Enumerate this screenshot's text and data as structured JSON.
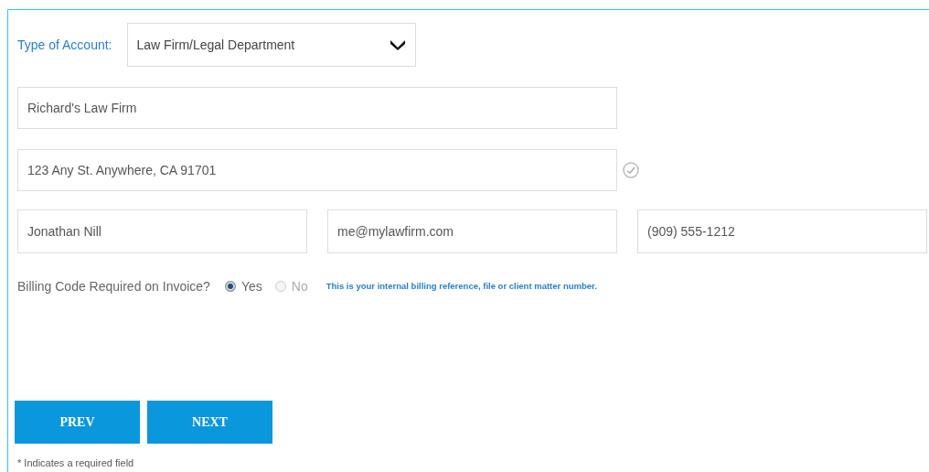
{
  "account_type": {
    "label": "Type of Account:",
    "value": "Law Firm/Legal Department"
  },
  "fields": [
    {
      "value": "Richard's Law Firm",
      "verified": false
    },
    {
      "value": "123 Any St. Anywhere, CA 91701",
      "verified": true
    }
  ],
  "contact_fields": [
    {
      "value": "Jonathan Nill"
    },
    {
      "value": "me@mylawfirm.com"
    },
    {
      "value": "(909) 555-1212"
    }
  ],
  "billing_code": {
    "question": "Billing Code Required on Invoice?",
    "options": [
      {
        "label": "Yes",
        "selected": true
      },
      {
        "label": "No",
        "selected": false
      }
    ],
    "hint": "This is your internal billing reference, file or client matter number."
  },
  "buttons": [
    "PREV",
    "NEXT"
  ],
  "footnote": "* Indicates a required field"
}
